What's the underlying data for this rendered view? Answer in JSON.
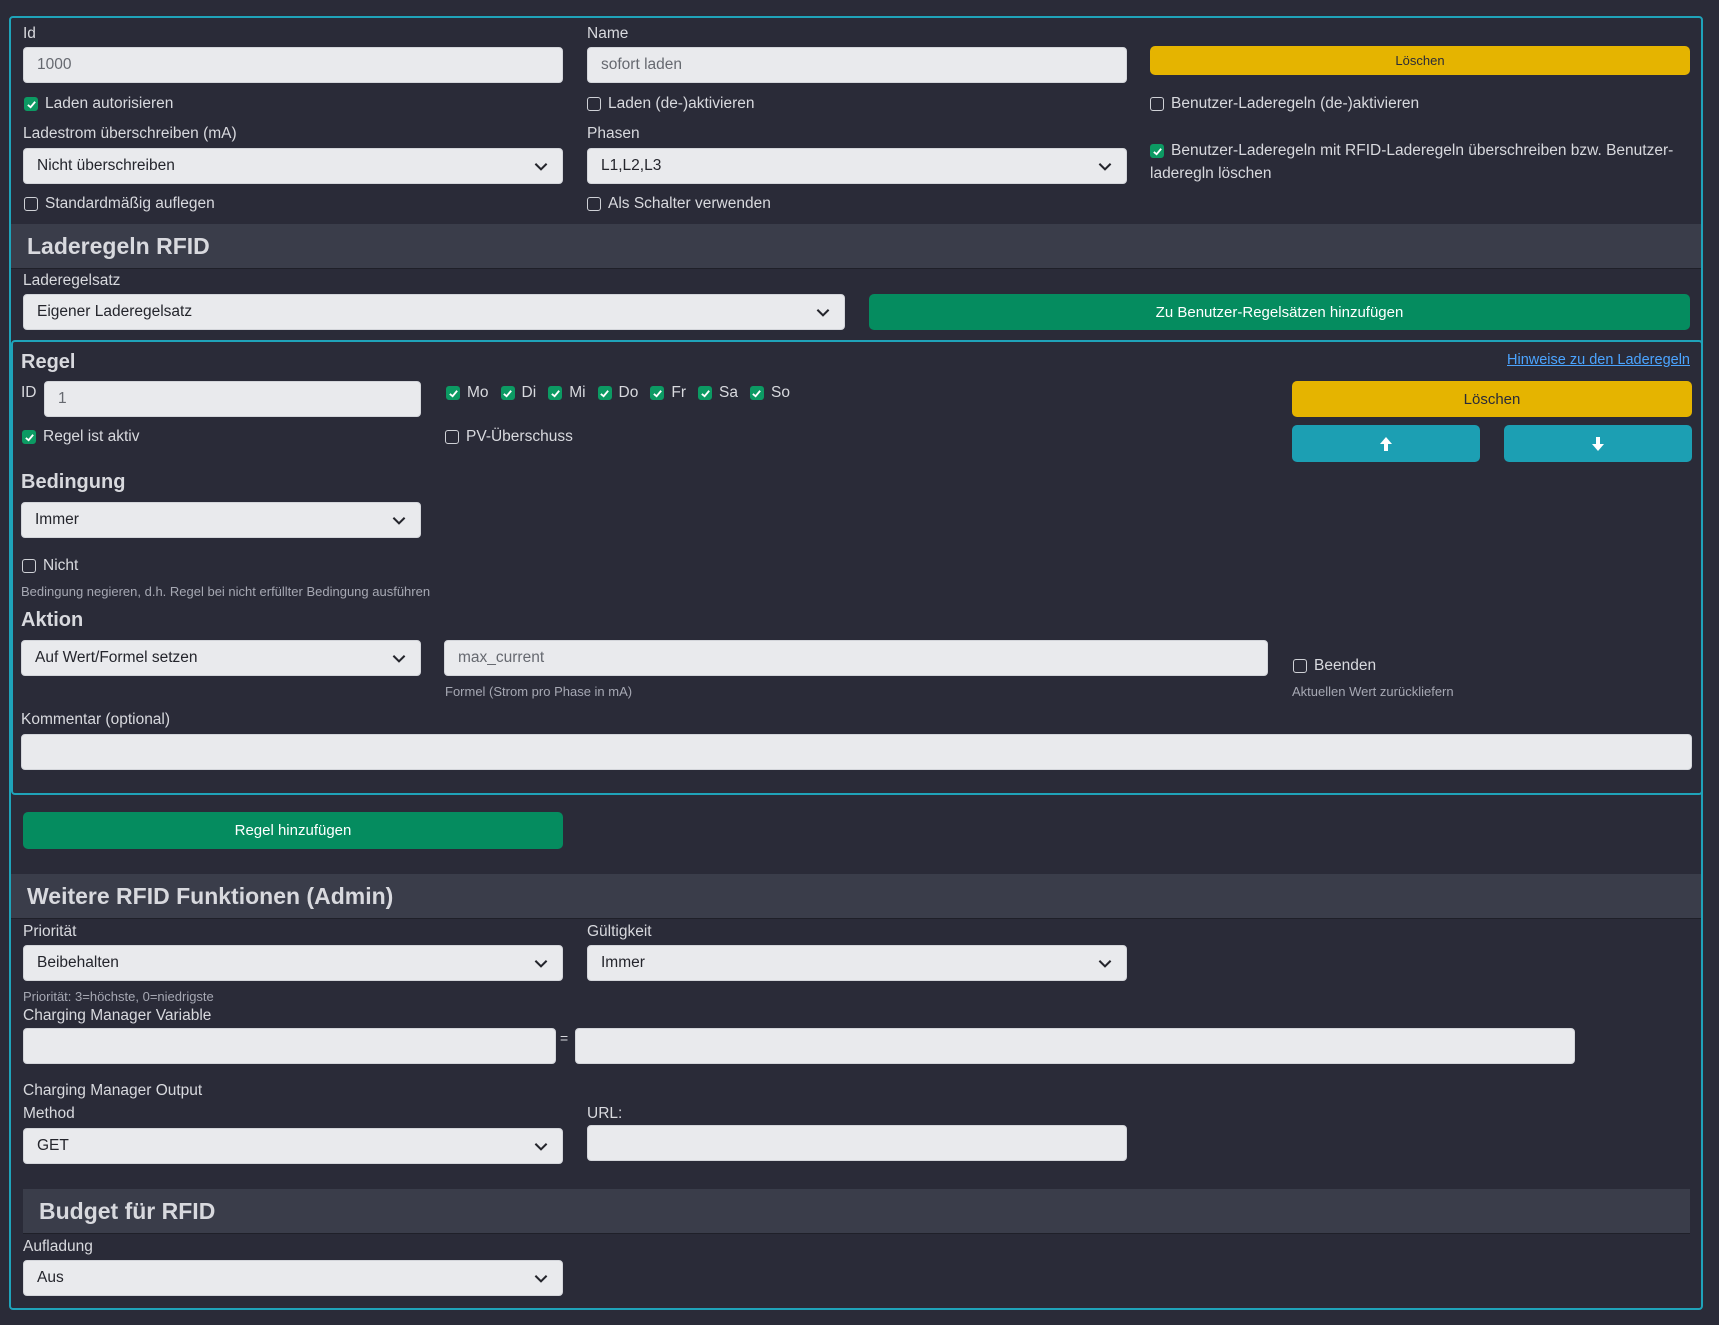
{
  "general": {
    "id_label": "Id",
    "id_value": "1000",
    "name_label": "Name",
    "name_value": "sofort laden",
    "delete_label": "Löschen",
    "authorize_label": "Laden autorisieren",
    "authorize_checked": true,
    "toggle_charge_label": "Laden (de-)aktivieren",
    "toggle_charge_checked": false,
    "user_rules_toggle_label": "Benutzer-Laderegeln (de-)aktivieren",
    "user_rules_toggle_checked": false,
    "current_override_label": "Ladestrom überschreiben (mA)",
    "current_override_value": "Nicht überschreiben",
    "phases_label": "Phasen",
    "phases_value": "L1,L2,L3",
    "override_user_rules_label_1": "Benutzer-Laderegeln mit RFID-Laderegeln überschreiben bzw. Benutzer-",
    "override_user_rules_label_2": "laderegln löschen",
    "override_user_rules_checked": true,
    "default_hangup_label": "Standardmäßig auflegen",
    "default_hangup_checked": false,
    "use_as_switch_label": "Als Schalter verwenden",
    "use_as_switch_checked": false
  },
  "rfid_rules": {
    "section_title": "Laderegeln RFID",
    "ruleset_label": "Laderegelsatz",
    "ruleset_value": "Eigener Laderegelsatz",
    "add_to_user_label": "Zu Benutzer-Regelsätzen hinzufügen"
  },
  "rule": {
    "title": "Regel",
    "hints_link": "Hinweise zu den Laderegeln",
    "id_label": "ID",
    "id_value": "1",
    "days": [
      {
        "label": "Mo",
        "checked": true
      },
      {
        "label": "Di",
        "checked": true
      },
      {
        "label": "Mi",
        "checked": true
      },
      {
        "label": "Do",
        "checked": true
      },
      {
        "label": "Fr",
        "checked": true
      },
      {
        "label": "Sa",
        "checked": true
      },
      {
        "label": "So",
        "checked": true
      }
    ],
    "delete_label": "Löschen",
    "active_label": "Regel ist aktiv",
    "active_checked": true,
    "pv_label": "PV-Überschuss",
    "pv_checked": false,
    "condition_title": "Bedingung",
    "condition_value": "Immer",
    "not_label": "Nicht",
    "not_checked": false,
    "not_hint": "Bedingung negieren, d.h. Regel bei nicht erfüllter Bedingung ausführen",
    "action_title": "Aktion",
    "action_value": "Auf Wert/Formel setzen",
    "formula_value": "max_current",
    "formula_hint": "Formel (Strom pro Phase in mA)",
    "finish_label": "Beenden",
    "finish_checked": false,
    "finish_hint": "Aktuellen Wert zurückliefern",
    "comment_label": "Kommentar (optional)",
    "comment_value": ""
  },
  "add_rule_label": "Regel hinzufügen",
  "admin": {
    "section_title": "Weitere RFID Funktionen (Admin)",
    "priority_label": "Priorität",
    "priority_value": "Beibehalten",
    "priority_hint": "Priorität: 3=höchste, 0=niedrigste",
    "validity_label": "Gültigkeit",
    "validity_value": "Immer",
    "cm_variable_label": "Charging Manager Variable",
    "cm_variable_name": "",
    "equals": "=",
    "cm_variable_value": "",
    "cm_output_label": "Charging Manager Output",
    "method_label": "Method",
    "method_value": "GET",
    "url_label": "URL:",
    "url_value": ""
  },
  "budget": {
    "section_title": "Budget für RFID",
    "charge_label": "Aufladung",
    "charge_value": "Aus"
  },
  "colors": {
    "background": "#2a2b38",
    "accent_frame": "#1fa3b9",
    "yellow_button": "#e5b400",
    "green_button": "#058c5f",
    "teal_button": "#1c9fb3",
    "checkbox_checked": "#0c9a63",
    "link": "#4ba4ff"
  }
}
